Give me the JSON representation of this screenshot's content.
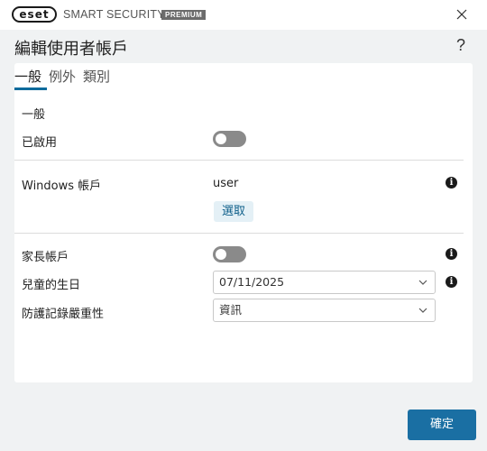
{
  "titlebar": {
    "logo": "eset",
    "product": "SMART SECURITY",
    "edition": "PREMIUM",
    "close_icon": "close-icon"
  },
  "header": {
    "title": "編輯使用者帳戶",
    "help": "?"
  },
  "tabs": [
    {
      "label": "一般",
      "active": true
    },
    {
      "label": "例外",
      "active": false
    },
    {
      "label": "類別",
      "active": false
    }
  ],
  "general": {
    "heading": "一般",
    "enabled_label": "已啟用",
    "enabled": false
  },
  "windows_account": {
    "label": "Windows 帳戶",
    "value": "user",
    "select_label": "選取"
  },
  "parent_account": {
    "label": "家長帳戶",
    "enabled": false
  },
  "birthday": {
    "label": "兒童的生日",
    "value": "07/11/2025"
  },
  "severity": {
    "label": "防護記錄嚴重性",
    "value": "資訊"
  },
  "footer": {
    "ok_label": "確定"
  },
  "colors": {
    "accent": "#1a6fa3",
    "tab_underline": "#0f6b9c",
    "toggle_off": "#8a8a8a",
    "select_bg": "#e4f0f6"
  }
}
